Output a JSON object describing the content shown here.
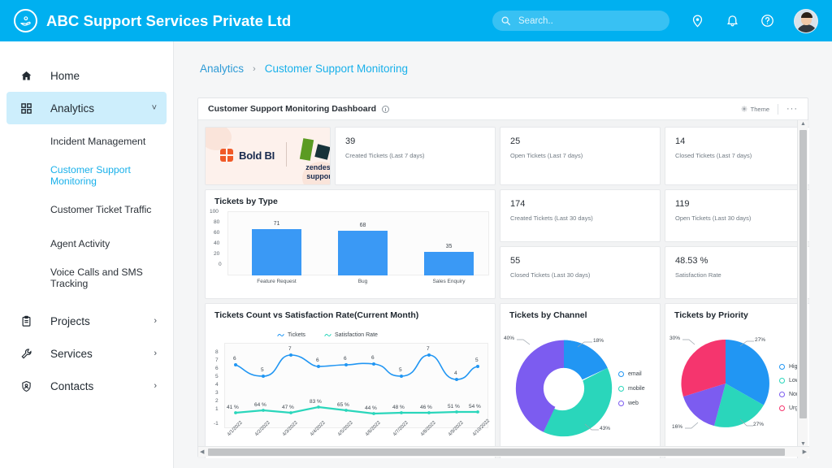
{
  "header": {
    "brand_name": "ABC Support Services Private Ltd",
    "brand_icon": "support-hand-icon",
    "search_placeholder": "Search..",
    "search_value": "",
    "icons": [
      "location-pin-icon",
      "bell-icon",
      "help-circle-icon",
      "avatar"
    ],
    "accent_color": "#00b0f0"
  },
  "sidebar": {
    "items": [
      {
        "label": "Home",
        "icon": "home-icon",
        "active": false,
        "chevron": ""
      },
      {
        "label": "Analytics",
        "icon": "grid-icon",
        "active": true,
        "chevron": "˅"
      },
      {
        "label": "Projects",
        "icon": "clipboard-icon",
        "active": false,
        "chevron": "›"
      },
      {
        "label": "Services",
        "icon": "wrench-icon",
        "active": false,
        "chevron": "›"
      },
      {
        "label": "Contacts",
        "icon": "shield-user-icon",
        "active": false,
        "chevron": "›"
      }
    ],
    "sub_items": [
      {
        "label": "Incident Management",
        "current": false
      },
      {
        "label": "Customer Support Monitoring",
        "current": true
      },
      {
        "label": "Customer Ticket Traffic",
        "current": false
      },
      {
        "label": "Agent Activity",
        "current": false
      },
      {
        "label": "Voice Calls and SMS Tracking",
        "current": false
      }
    ]
  },
  "breadcrumb": {
    "parent": "Analytics",
    "separator": "›",
    "current": "Customer Support Monitoring"
  },
  "dashboard": {
    "title": "Customer Support Monitoring Dashboard",
    "info_icon": "info-circle-icon",
    "theme_label": "Theme",
    "theme_icon": "gear-icon",
    "more_label": "···"
  },
  "logo_widget": {
    "boldbi_text": "Bold BI",
    "zendesk_line1": "zendesk",
    "zendesk_line2": "support",
    "boldbi_color": "#f05a28",
    "zendesk_green": "#5b9b23",
    "zendesk_dark": "#18333a"
  },
  "kpis": [
    {
      "value": "39",
      "label": "Created Tickets (Last 7 days)"
    },
    {
      "value": "25",
      "label": "Open Tickets (Last 7 days)"
    },
    {
      "value": "14",
      "label": "Closed Tickets (Last 7 days)"
    },
    {
      "value": "174",
      "label": "Created Tickets (Last 30 days)"
    },
    {
      "value": "119",
      "label": "Open Tickets (Last 30 days)"
    },
    {
      "value": "55",
      "label": "Closed Tickets (Last 30 days)"
    },
    {
      "value": "48.53 %",
      "label": "Satisfaction Rate"
    }
  ],
  "chart_data": [
    {
      "type": "bar",
      "title": "Tickets by Type",
      "categories": [
        "Feature Request",
        "Bug",
        "Sales Enquiry"
      ],
      "values": [
        71,
        68,
        35
      ],
      "ylim": [
        0,
        100
      ],
      "yticks": [
        0,
        20,
        40,
        60,
        80,
        100
      ],
      "xlabel": "",
      "ylabel": "",
      "grid": false,
      "bar_color": "#3a99f5"
    },
    {
      "type": "line",
      "title": "Tickets Count vs Satisfaction Rate(Current Month)",
      "x": [
        "4/1/2022",
        "4/2/2022",
        "4/3/2022",
        "4/4/2022",
        "4/5/2022",
        "4/6/2022",
        "4/7/2022",
        "4/8/2022",
        "4/9/2022",
        "4/10/2022"
      ],
      "ylim": [
        -1,
        8
      ],
      "yticks": [
        -1,
        1,
        2,
        3,
        4,
        5,
        6,
        7,
        8
      ],
      "legend_position": "top",
      "series": [
        {
          "name": "Tickets",
          "color": "#2196f3",
          "values": [
            6,
            5,
            7,
            6,
            6,
            6,
            5,
            7,
            4,
            5
          ],
          "labels": [
            "6",
            "5",
            "7",
            "6",
            "6",
            "6",
            "5",
            "7",
            "4",
            "5"
          ]
        },
        {
          "name": "Satisfaction Rate",
          "color": "#2ad6bb",
          "values": [
            41,
            64,
            47,
            83,
            65,
            44,
            48,
            46,
            51,
            54
          ],
          "labels": [
            "41 %",
            "64 %",
            "47 %",
            "83 %",
            "65 %",
            "44 %",
            "48 %",
            "46 %",
            "51 %",
            "54 %"
          ]
        }
      ]
    },
    {
      "type": "pie",
      "variant": "donut",
      "title": "Tickets by Channel",
      "categories": [
        "email",
        "mobile",
        "web"
      ],
      "values": [
        18,
        43,
        40
      ],
      "labels": [
        "18%",
        "43%",
        "40%"
      ],
      "colors": [
        "#2196f3",
        "#2ad6bb",
        "#7c5cf0"
      ],
      "legend_position": "right"
    },
    {
      "type": "pie",
      "title": "Tickets by Priority",
      "categories": [
        "High",
        "Low",
        "Normal",
        "Urgent"
      ],
      "values": [
        27,
        27,
        16,
        30
      ],
      "labels": [
        "27%",
        "27%",
        "16%",
        "30%"
      ],
      "colors": [
        "#2196f3",
        "#2ad6bb",
        "#7c5cf0",
        "#f5356e"
      ],
      "legend_position": "right"
    }
  ]
}
